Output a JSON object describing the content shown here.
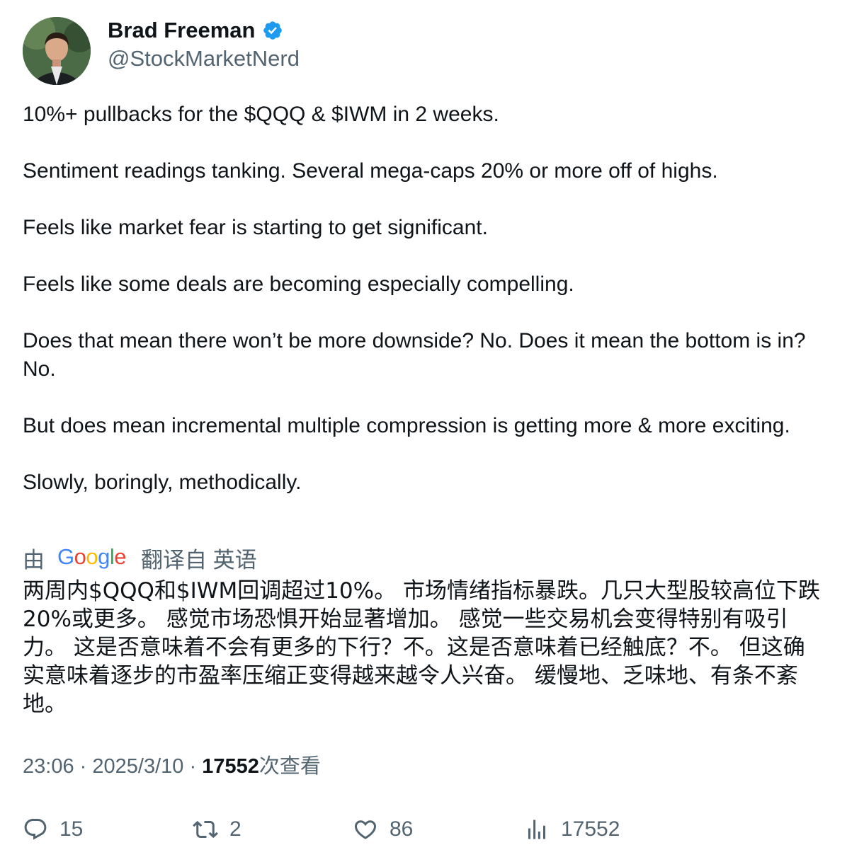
{
  "author": {
    "display_name": "Brad Freeman",
    "handle": "@StockMarketNerd",
    "verified": true,
    "verified_color": "#1d9bf0"
  },
  "tweet": {
    "paragraphs": [
      "10%+ pullbacks for the $QQQ & $IWM in 2 weeks.",
      "Sentiment readings tanking. Several mega-caps 20% or more off of highs.",
      "Feels like market fear is starting to get significant.",
      "Feels like some deals are becoming especially compelling.",
      "Does that mean there won’t be more downside? No. Does it mean the bottom is in? No.",
      "But does mean incremental multiple compression is getting more & more exciting.",
      "Slowly, boringly, methodically."
    ]
  },
  "translation": {
    "prefix": "由",
    "provider": "Google",
    "suffix": "翻译自 英语",
    "text": "两周内$QQQ和$IWM回调超过10%。 市场情绪指标暴跌。几只大型股较高位下跌20%或更多。 感觉市场恐惧开始显著增加。 感觉一些交易机会变得特别有吸引力。 这是否意味着不会有更多的下行？不。这是否意味着已经触底？不。 但这确实意味着逐步的市盈率压缩正变得越来越令人兴奋。 缓慢地、乏味地、有条不紊地。"
  },
  "meta": {
    "time": "23:06",
    "date": "2025/3/10",
    "separator": "·",
    "views": "17552",
    "views_label": "次查看"
  },
  "actions": {
    "replies": "15",
    "retweets": "2",
    "likes": "86",
    "views": "17552"
  },
  "colors": {
    "text_primary": "#0f1419",
    "text_secondary": "#536471",
    "google_blue": "#4285f4",
    "google_red": "#ea4335",
    "google_yellow": "#fbbc05",
    "google_green": "#34a853"
  }
}
